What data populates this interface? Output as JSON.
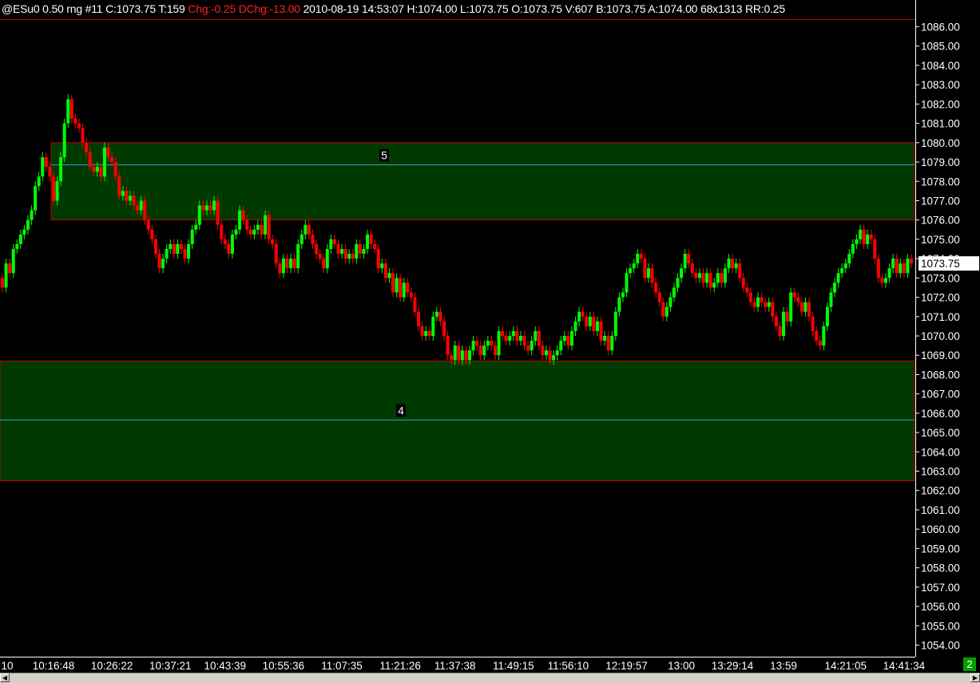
{
  "header": {
    "symbol": "@ESu0",
    "bar_type": "0.50 rng",
    "bar_num": "#11",
    "close": "C:1073.75",
    "ticks": "T:159",
    "chg": "Chg:-0.25",
    "dchg": "DChg:-13.00",
    "datetime": "2010-08-19 14:53:07",
    "high": "H:1074.00",
    "low": "L:1073.75",
    "open": "O:1073.75",
    "volume": "V:607",
    "bid": "B:1073.75",
    "ask": "A:1074.00",
    "size": "68x1313",
    "rr": "RR:0.25"
  },
  "colors": {
    "background": "#000000",
    "up_bar": "#00ff00",
    "down_bar": "#ff0000",
    "zone_fill": "#003a00",
    "zone_border": "#c00000",
    "zone_midline": "#3aa0c8",
    "axis_text": "#ffffff"
  },
  "page_badge": "2",
  "chart_data": {
    "type": "candlestick",
    "ylim": [
      1054,
      1086
    ],
    "y_ticks": [
      "1086.00",
      "1085.00",
      "1084.00",
      "1083.00",
      "1082.00",
      "1081.00",
      "1080.00",
      "1079.00",
      "1078.00",
      "1077.00",
      "1076.00",
      "1075.00",
      "1074.00",
      "1073.00",
      "1072.00",
      "1071.00",
      "1070.00",
      "1069.00",
      "1068.00",
      "1067.00",
      "1066.00",
      "1065.00",
      "1064.00",
      "1063.00",
      "1062.00",
      "1061.00",
      "1060.00",
      "1059.00",
      "1058.00",
      "1057.00",
      "1056.00",
      "1055.00",
      "1054.00"
    ],
    "x_tick_labels": [
      "10",
      "10:16:48",
      "10:26:22",
      "10:37:21",
      "10:43:39",
      "10:55:36",
      "11:07:35",
      "11:21:26",
      "11:37:38",
      "11:49:15",
      "11:56:10",
      "12:19:57",
      "13:00",
      "13:29:14",
      "13:59",
      "14:21:05",
      "14:41:34"
    ],
    "x_tick_positions": [
      0,
      14,
      30,
      46,
      61,
      77,
      93,
      109,
      124,
      140,
      155,
      171,
      186,
      200,
      214,
      231,
      247
    ],
    "bar_count": 250,
    "last_price_label": "1073.75",
    "last_price": 1073.75,
    "zones": [
      {
        "label": "5",
        "top": 1080.0,
        "bottom": 1076.0,
        "mid": 1078.85,
        "start_index": 14
      },
      {
        "label": "4",
        "top": 1068.7,
        "bottom": 1062.5,
        "mid": 1065.65,
        "start_index": 0
      }
    ],
    "closes": [
      1073.0,
      1074.5,
      1075.5,
      1079.5,
      1077.0,
      1082.0,
      1080.0,
      1078.0,
      1080.0,
      1077.0,
      1077.0,
      1076.0,
      1073.5,
      1075.0,
      1074.5,
      1076.5,
      1076.5,
      1074.0,
      1076.5,
      1075.0,
      1076.0,
      1073.5,
      1074.0,
      1075.5,
      1073.5,
      1075.5,
      1074.0,
      1074.5,
      1075.0,
      1073.0,
      1072.5,
      1072.0,
      1070.0,
      1071.0,
      1069.0,
      1069.0,
      1069.0,
      1069.5,
      1070.0,
      1070.0,
      1069.5,
      1069.0,
      1069.0,
      1070.0,
      1071.0,
      1070.5,
      1069.5,
      1072.5,
      1073.5,
      1073.5,
      1071.0,
      1073.0,
      1074.0,
      1073.0,
      1072.5,
      1074.0,
      1073.0,
      1072.0,
      1071.5,
      1071.0,
      1072.0,
      1071.0,
      1069.5,
      1072.5,
      1073.5,
      1075.0,
      1074.5,
      1072.5,
      1073.5,
      1073.75
    ]
  }
}
